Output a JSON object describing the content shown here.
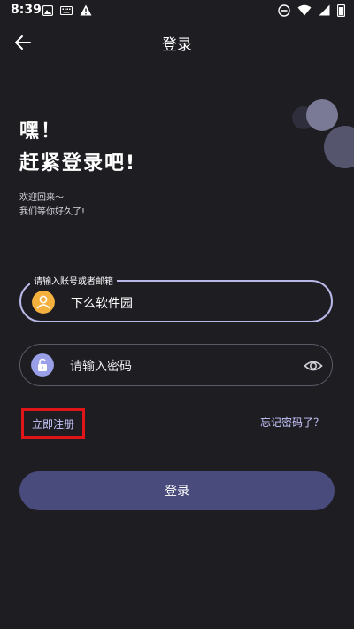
{
  "status_bar": {
    "time": "8:39",
    "left_icons": [
      "image-icon",
      "keyboard-icon",
      "warning-icon"
    ],
    "right_icons": [
      "dnd-icon",
      "wifi-icon",
      "signal-icon",
      "battery-icon"
    ]
  },
  "header": {
    "title": "登录"
  },
  "greeting": {
    "line1": "嘿！",
    "line2": "赶紧登录吧!",
    "sub1": "欢迎回来～",
    "sub2": "我们等你好久了!"
  },
  "account_field": {
    "label": "请输入账号或者邮箱",
    "value": "下么软件园",
    "icon": "user-icon",
    "icon_color": "#f5b13d"
  },
  "password_field": {
    "placeholder": "请输入密码",
    "icon": "lock-icon",
    "icon_color": "#9aa0e8"
  },
  "links": {
    "register": "立即注册",
    "forgot": "忘记密码了？"
  },
  "login_button": {
    "label": "登录"
  },
  "colors": {
    "background": "#1e1d22",
    "accent": "#4a4b7d",
    "highlight_box": "#e0151a"
  }
}
